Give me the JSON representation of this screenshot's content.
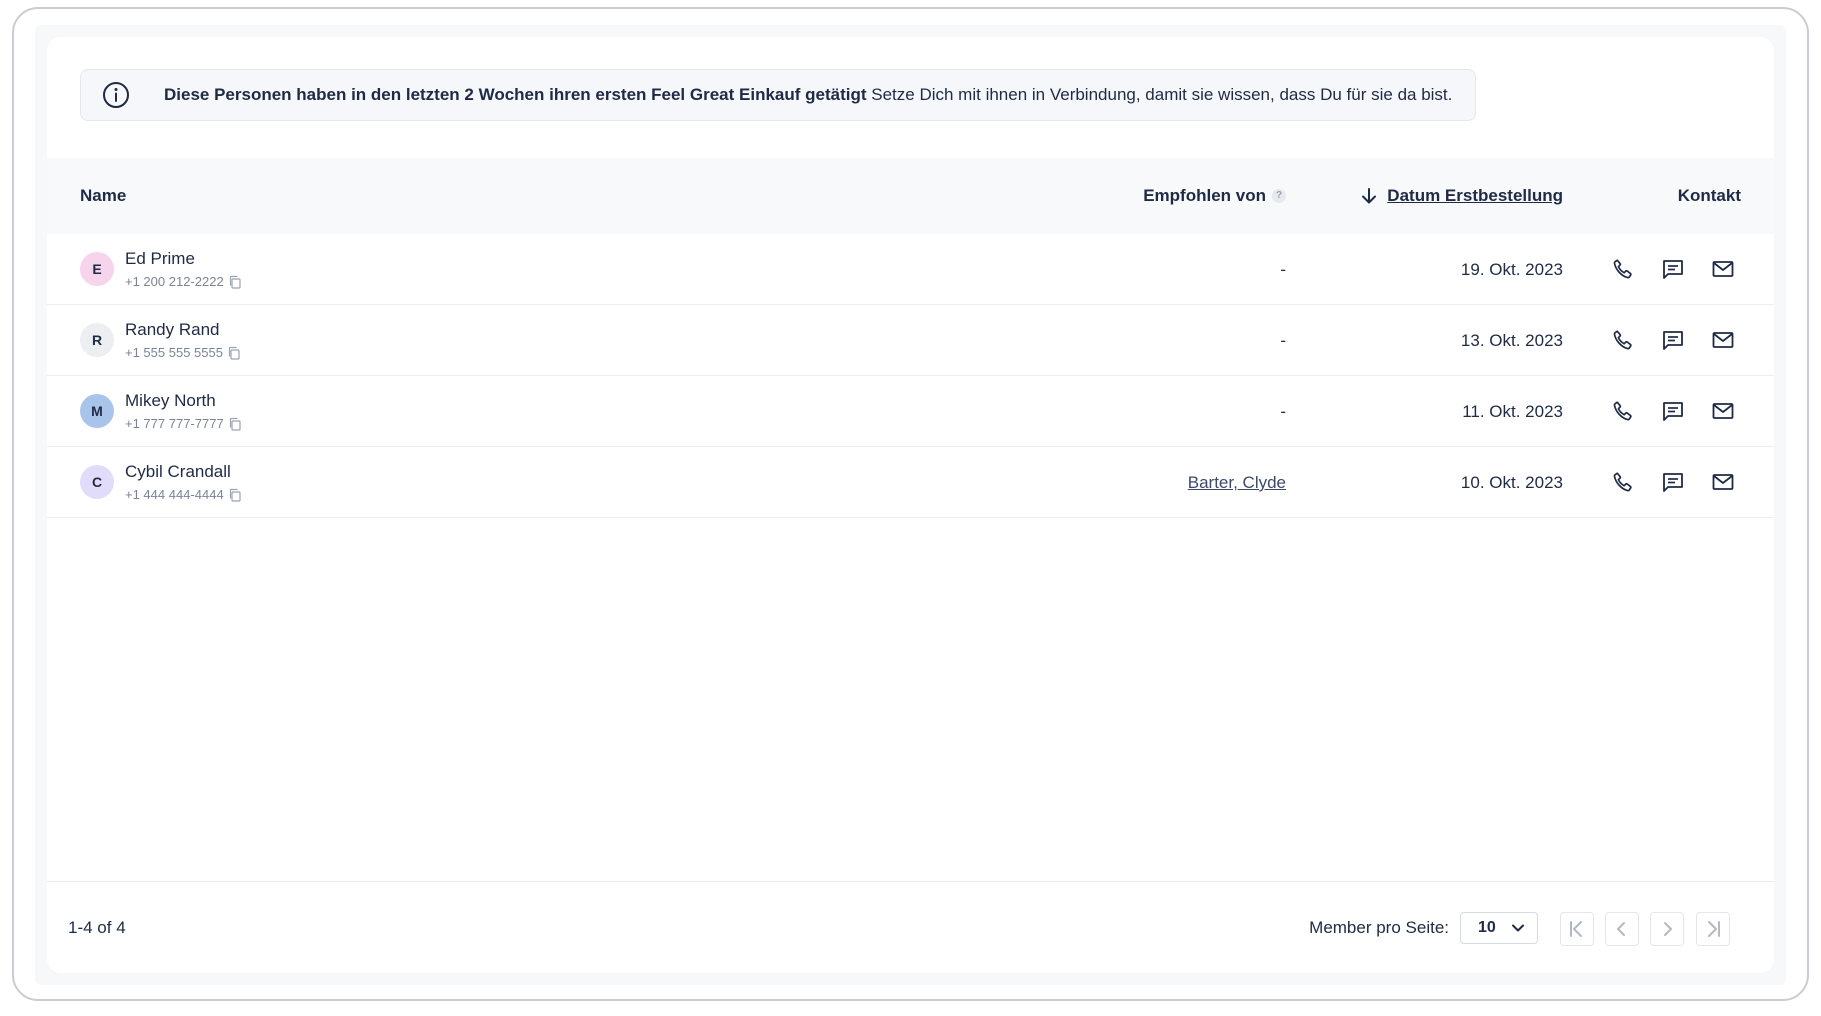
{
  "banner": {
    "bold_text": "Diese Personen haben in den letzten 2 Wochen ihren ersten Feel Great Einkauf getätigt",
    "text": " Setze Dich mit ihnen in Verbindung, damit sie wissen, dass Du für sie da bist."
  },
  "table": {
    "headers": {
      "name": "Name",
      "referred_by": "Empfohlen von",
      "referred_by_help": "?",
      "date": "Datum Erstbestellung",
      "contact": "Kontakt"
    },
    "rows": [
      {
        "initial": "E",
        "avatar_color": "#f6d4ec",
        "name": "Ed Prime",
        "phone": "+1 200 212-2222",
        "referred_by": "-",
        "date": "19. Okt. 2023"
      },
      {
        "initial": "R",
        "avatar_color": "#eceef2",
        "name": "Randy Rand",
        "phone": "+1 555 555 5555",
        "referred_by": "-",
        "date": "13. Okt. 2023"
      },
      {
        "initial": "M",
        "avatar_color": "#a8c4ea",
        "name": "Mikey North",
        "phone": "+1 777 777-7777",
        "referred_by": "-",
        "date": "11. Okt. 2023"
      },
      {
        "initial": "C",
        "avatar_color": "#e2dcfb",
        "name": "Cybil Crandall",
        "phone": "+1 444 444-4444",
        "referred_by": "Barter, Clyde",
        "date": "10. Okt. 2023"
      }
    ]
  },
  "icons": {
    "info": "info-icon",
    "sort": "arrow-down-icon",
    "copy": "copy-icon",
    "phone": "phone-icon",
    "chat": "chat-icon",
    "mail": "mail-icon"
  },
  "footer": {
    "range": "1-4 of 4",
    "per_page_label": "Member pro Seite:",
    "per_page_value": "10"
  }
}
